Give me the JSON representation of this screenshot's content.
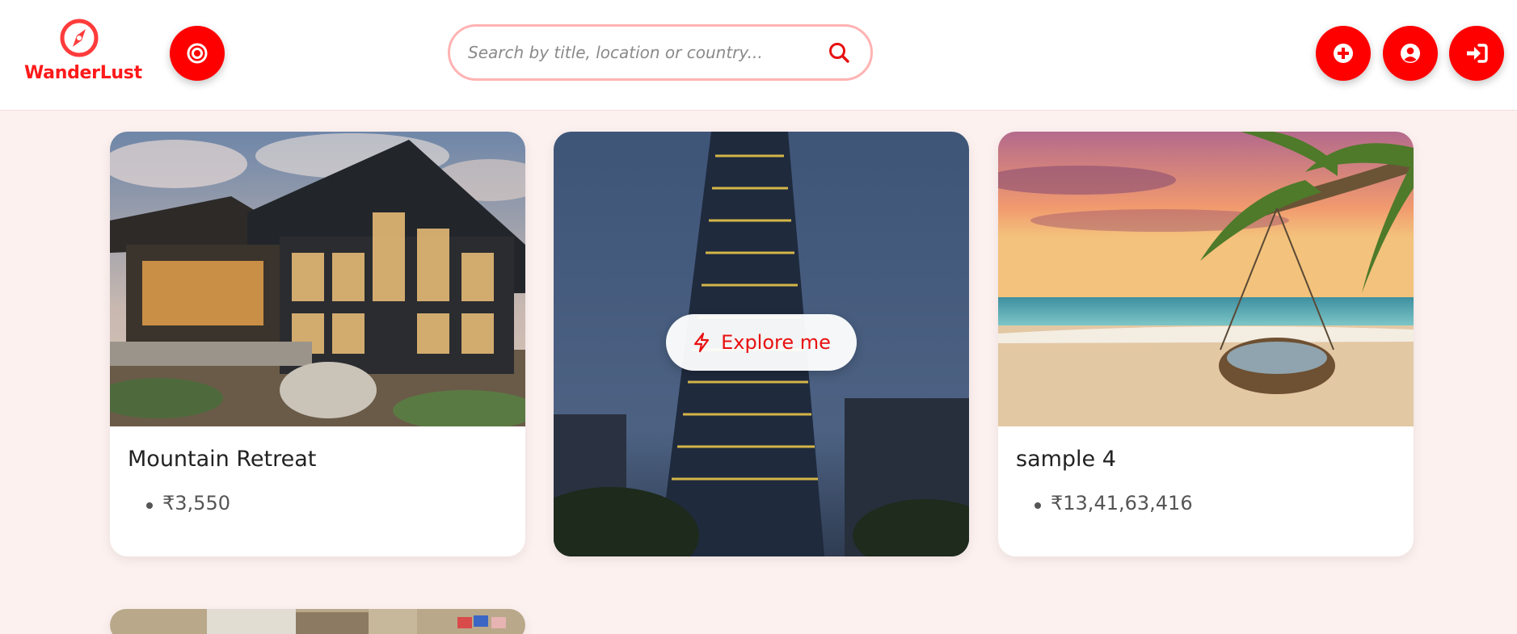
{
  "brand": {
    "name": "WanderLust",
    "icon": "compass-icon"
  },
  "filter_button": {
    "icon": "target-icon"
  },
  "search": {
    "placeholder": "Search by title, location or country...",
    "value": ""
  },
  "actions": [
    {
      "name": "add-listing-button",
      "icon": "plus-circle-icon"
    },
    {
      "name": "profile-button",
      "icon": "user-circle-icon"
    },
    {
      "name": "login-button",
      "icon": "sign-in-icon"
    }
  ],
  "colors": {
    "accent": "#ff0000",
    "background": "#fdf1f0",
    "search_border": "#ffb3b3"
  },
  "listings": [
    {
      "title": "Mountain Retreat",
      "price": "₹3,550"
    },
    {
      "explore_label": "Explore me"
    },
    {
      "title": "sample 4",
      "price": "₹13,41,63,416"
    }
  ]
}
